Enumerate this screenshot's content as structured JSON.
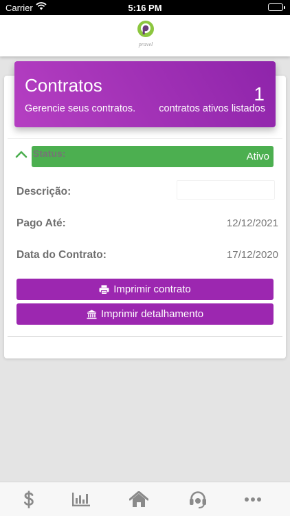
{
  "status_bar": {
    "carrier": "Carrier",
    "time": "5:16 PM"
  },
  "header": {
    "logo_text": "pravel"
  },
  "hero": {
    "title": "Contratos",
    "subtitle": "Gerencie seus contratos.",
    "count": "1",
    "count_label": "contratos ativos listados"
  },
  "contract": {
    "status_label": "Status:",
    "status_value": "Ativo",
    "description_label": "Descrição:",
    "description_value": "",
    "paid_until_label": "Pago Até:",
    "paid_until_value": "12/12/2021",
    "contract_date_label": "Data do Contrato:",
    "contract_date_value": "17/12/2020",
    "print_contract_label": "Imprimir contrato",
    "print_detail_label": "Imprimir detalhamento"
  },
  "tabbar": {
    "items": [
      {
        "icon": "dollar-icon"
      },
      {
        "icon": "bar-chart-icon"
      },
      {
        "icon": "home-icon"
      },
      {
        "icon": "headset-icon"
      },
      {
        "icon": "more-icon"
      }
    ]
  },
  "colors": {
    "accent_purple": "#9c27b0",
    "status_green": "#4caf50",
    "logo_green": "#8cc63f",
    "tab_icon_gray": "#8a8a8a"
  }
}
